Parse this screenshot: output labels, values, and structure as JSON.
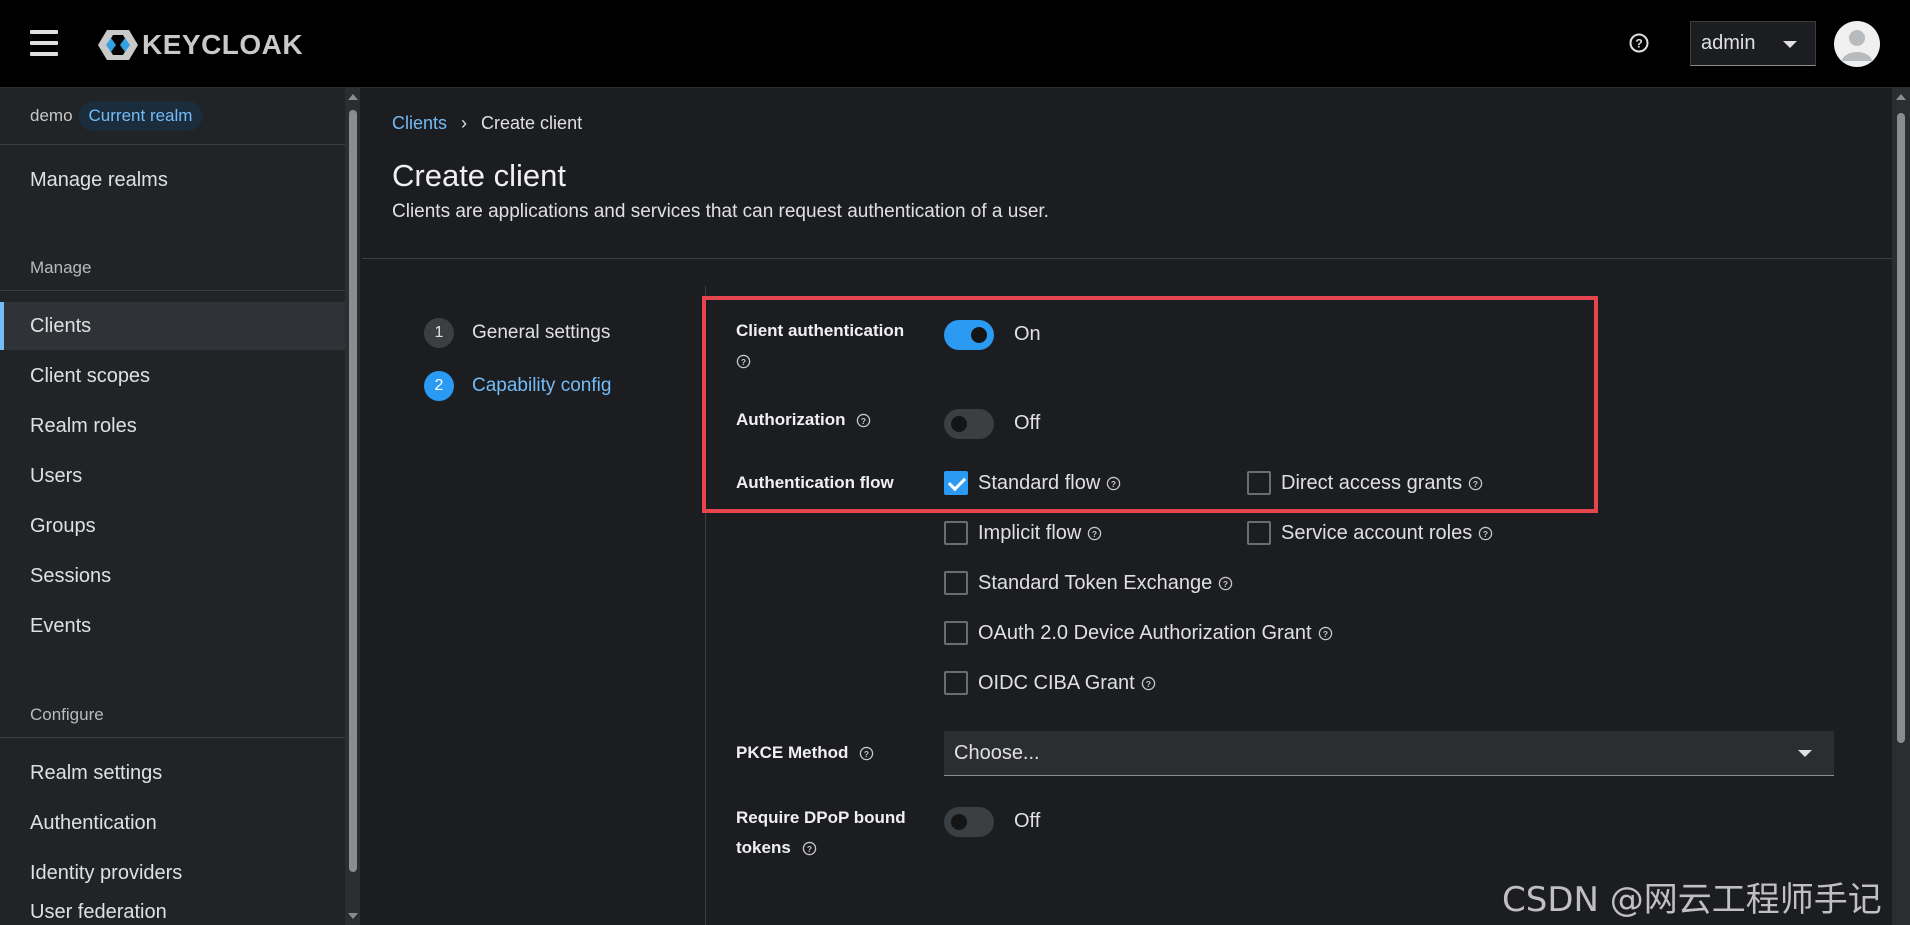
{
  "masthead": {
    "logo_text": "KEYCLOAK",
    "user_label": "admin"
  },
  "sidebar": {
    "realm": {
      "name": "demo",
      "badge": "Current realm"
    },
    "manage_realms": "Manage realms",
    "sections": {
      "manage": "Manage",
      "configure": "Configure"
    },
    "manage_items": [
      "Clients",
      "Client scopes",
      "Realm roles",
      "Users",
      "Groups",
      "Sessions",
      "Events"
    ],
    "configure_items": [
      "Realm settings",
      "Authentication",
      "Identity providers",
      "User federation"
    ],
    "active_item": "Clients"
  },
  "main": {
    "breadcrumb": {
      "link": "Clients",
      "current": "Create client"
    },
    "title": "Create client",
    "description": "Clients are applications and services that can request authentication of a user.",
    "steps": [
      {
        "num": "1",
        "label": "General settings",
        "active": false
      },
      {
        "num": "2",
        "label": "Capability config",
        "active": true
      }
    ],
    "form": {
      "client_auth": {
        "label": "Client authentication",
        "value": "On",
        "enabled": true
      },
      "authorization": {
        "label": "Authorization",
        "value": "Off",
        "enabled": false
      },
      "auth_flow": {
        "label": "Authentication flow",
        "options": {
          "standard_flow": {
            "label": "Standard flow",
            "checked": true
          },
          "direct_access": {
            "label": "Direct access grants",
            "checked": false
          },
          "implicit_flow": {
            "label": "Implicit flow",
            "checked": false
          },
          "service_account": {
            "label": "Service account roles",
            "checked": false
          },
          "token_exchange": {
            "label": "Standard Token Exchange",
            "checked": false
          },
          "device_grant": {
            "label": "OAuth 2.0 Device Authorization Grant",
            "checked": false
          },
          "ciba": {
            "label": "OIDC CIBA Grant",
            "checked": false
          }
        }
      },
      "pkce": {
        "label": "PKCE Method",
        "placeholder": "Choose..."
      },
      "dpop": {
        "label_line1": "Require DPoP bound",
        "label_line2": "tokens",
        "value": "Off",
        "enabled": false
      }
    }
  },
  "watermark": "CSDN @网云工程师手记",
  "colors": {
    "accent": "#2b9af3",
    "link": "#73bcf7",
    "highlight": "#e5454c"
  }
}
